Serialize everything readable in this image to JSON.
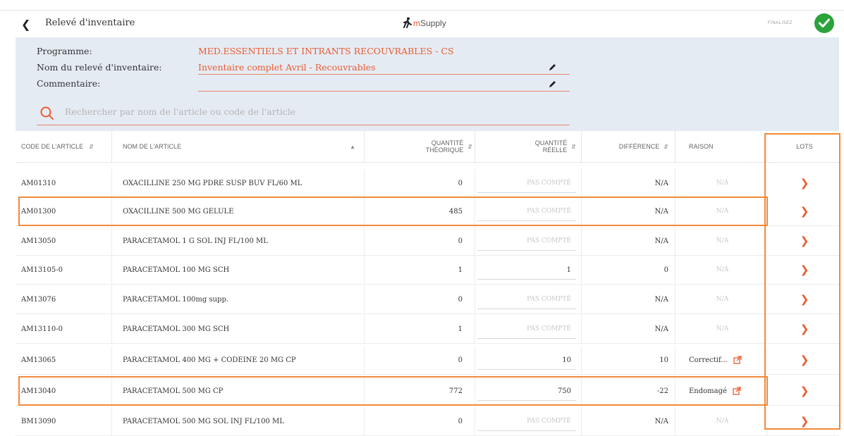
{
  "topbar": {
    "back_icon": "chevron-left-icon",
    "title": "Relevé d'inventaire",
    "brand_m": "m",
    "brand_rest": "Supply",
    "finalise_label": "FINALISEZ",
    "status_icon": "check-circle-icon"
  },
  "header": {
    "programme_label": "Programme:",
    "programme_value": "MED.ESSENTIELS ET INTRANTS RECOUVRABLES - CS",
    "name_label": "Nom du relevé d'inventaire:",
    "name_value": "Inventaire complet Avril - Recouvrables",
    "comment_label": "Commentaire:",
    "comment_value": "",
    "search_placeholder": "Rechercher par nom de l'article ou code de l'article"
  },
  "columns": {
    "code": "CODE DE L'ARTICLE",
    "name": "NOM DE L'ARTICLE",
    "theo": "QUANTITÉ THÉORIQUE",
    "reel": "QUANTITÉ RÉELLE",
    "diff": "DIFFÉRENCE",
    "raison": "RAISON",
    "lots": "LOTS"
  },
  "rows": [
    {
      "code": "AM01310",
      "name": "OXACILLINE 250 MG PDRE SUSP BUV FL/60 ML",
      "theo": "0",
      "reel": "PAS COMPTÉ",
      "diff": "N/A",
      "raison": "N/A"
    },
    {
      "code": "AM01300",
      "name": "OXACILLINE 500 MG GELULE",
      "theo": "485",
      "reel": "PAS COMPTÉ",
      "diff": "N/A",
      "raison": "N/A"
    },
    {
      "code": "AM13050",
      "name": "PARACETAMOL 1 G SOL INJ FL/100 ML",
      "theo": "0",
      "reel": "PAS COMPTÉ",
      "diff": "N/A",
      "raison": "N/A"
    },
    {
      "code": "AM13105-0",
      "name": "PARACETAMOL 100 MG SCH",
      "theo": "1",
      "reel": "1",
      "diff": "0",
      "raison": "N/A"
    },
    {
      "code": "AM13076",
      "name": "PARACETAMOL 100mg supp.",
      "theo": "0",
      "reel": "PAS COMPTÉ",
      "diff": "N/A",
      "raison": "N/A"
    },
    {
      "code": "AM13110-0",
      "name": "PARACETAMOL 300 MG SCH",
      "theo": "1",
      "reel": "PAS COMPTÉ",
      "diff": "N/A",
      "raison": "N/A"
    },
    {
      "code": "AM13065",
      "name": "PARACETAMOL 400 MG + CODEINE 20 MG CP",
      "theo": "0",
      "reel": "10",
      "diff": "10",
      "raison": "Correctif..."
    },
    {
      "code": "AM13040",
      "name": "PARACETAMOL 500 MG CP",
      "theo": "772",
      "reel": "750",
      "diff": "-22",
      "raison": "Endomagé"
    },
    {
      "code": "BM13090",
      "name": "PARACETAMOL 500 MG SOL INJ FL/100 ML",
      "theo": "0",
      "reel": "PAS COMPTÉ",
      "diff": "N/A",
      "raison": "N/A"
    }
  ],
  "colors": {
    "accent": "#e95c30",
    "header_bg": "#e5ebf3",
    "highlight": "#f28a3a",
    "success": "#2aa33a"
  }
}
